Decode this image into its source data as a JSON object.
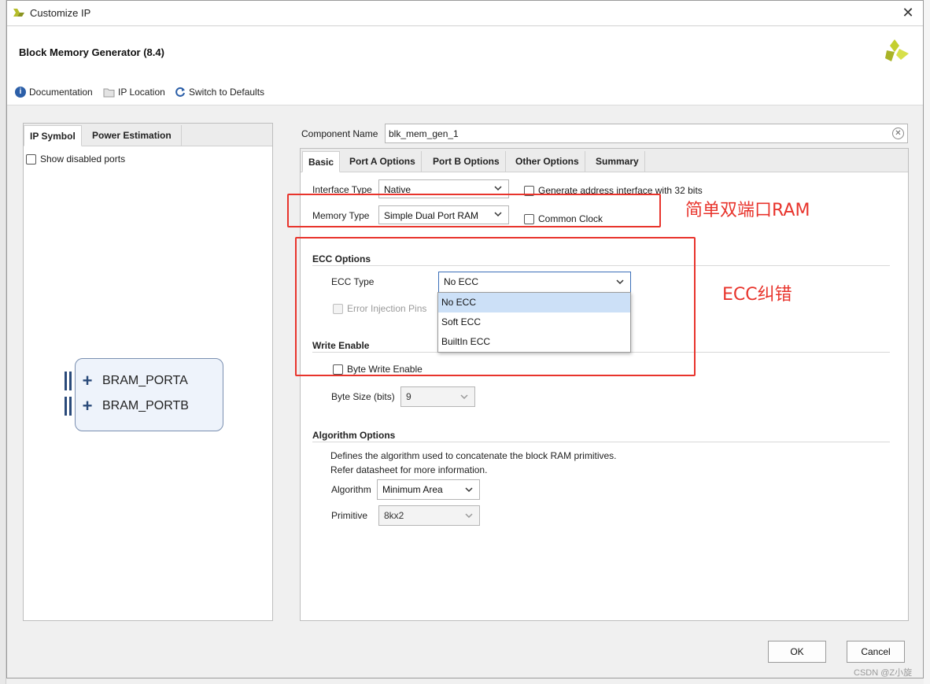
{
  "window": {
    "title": "Customize IP",
    "ip_title": "Block Memory Generator (8.4)"
  },
  "toolbar": {
    "documentation": "Documentation",
    "ip_location": "IP Location",
    "switch_defaults": "Switch to Defaults"
  },
  "left_panel": {
    "tabs": [
      "IP Symbol",
      "Power Estimation"
    ],
    "show_disabled": "Show disabled ports",
    "ports": [
      "BRAM_PORTA",
      "BRAM_PORTB"
    ]
  },
  "component": {
    "label": "Component Name",
    "value": "blk_mem_gen_1"
  },
  "tabs": [
    "Basic",
    "Port A Options",
    "Port B Options",
    "Other Options",
    "Summary"
  ],
  "basic": {
    "interface_type_label": "Interface Type",
    "interface_type_value": "Native",
    "memory_type_label": "Memory Type",
    "memory_type_value": "Simple Dual Port RAM",
    "gen_addr_label": "Generate address interface with 32 bits",
    "common_clock_label": "Common Clock",
    "ecc_section": "ECC Options",
    "ecc_type_label": "ECC Type",
    "ecc_type_value": "No ECC",
    "ecc_options": [
      "No ECC",
      "Soft ECC",
      "BuiltIn ECC"
    ],
    "error_injection_label": "Error Injection Pins",
    "write_enable_section": "Write Enable",
    "byte_write_enable_label": "Byte Write Enable",
    "byte_size_label": "Byte Size (bits)",
    "byte_size_value": "9",
    "algorithm_section": "Algorithm Options",
    "algorithm_desc_1": "Defines the algorithm used to concatenate the block RAM primitives.",
    "algorithm_desc_2": "Refer datasheet for more information.",
    "algorithm_label": "Algorithm",
    "algorithm_value": "Minimum Area",
    "primitive_label": "Primitive",
    "primitive_value": "8kx2"
  },
  "annotations": {
    "memory_note": "简单双端口RAM",
    "ecc_note": "ECC纠错"
  },
  "buttons": {
    "ok": "OK",
    "cancel": "Cancel"
  },
  "watermark": "CSDN @Z小旋",
  "colors": {
    "annotation_red": "#e8342c",
    "xilinx_logo": "#c4cf2f",
    "selected_item": "#cce0f7"
  }
}
